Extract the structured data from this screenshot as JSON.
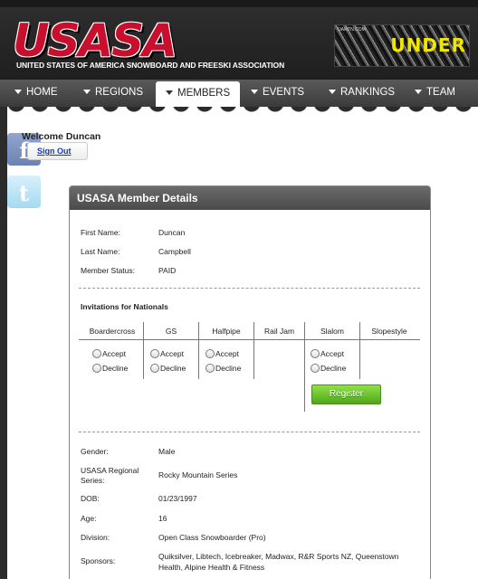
{
  "header": {
    "topstrip_text": "",
    "logo_text": "USASA",
    "logo_tagline": "UNITED STATES OF AMERICA SNOWBOARD AND FREESKI ASSOCIATION",
    "banner_small": "UAMTN.COM",
    "banner_word": "UNDER"
  },
  "nav": {
    "items": [
      {
        "label": "HOME"
      },
      {
        "label": "REGIONS"
      },
      {
        "label": "MEMBERS"
      },
      {
        "label": "EVENTS"
      },
      {
        "label": "RANKINGS"
      },
      {
        "label": "TEAM"
      }
    ],
    "active": "MEMBERS"
  },
  "social": {
    "facebook_glyph": "f",
    "twitter_glyph": "t"
  },
  "user": {
    "welcome": "Welcome Duncan",
    "sign_out": "Sign Out"
  },
  "panel": {
    "title": "USASA Member Details",
    "first_name_label": "First Name:",
    "first_name": "Duncan",
    "last_name_label": "Last Name:",
    "last_name": "Campbell",
    "status_label": "Member Status:",
    "status": "PAID",
    "invitations_title": "Invitations for Nationals",
    "invitation_columns": [
      "Boardercross",
      "GS",
      "Halfpipe",
      "Rail Jam",
      "Slalom",
      "Slopestyle"
    ],
    "accept_label": "Accept",
    "decline_label": "Decline",
    "register_label": "Register",
    "gender_label": "Gender:",
    "gender": "Male",
    "region_label": "USASA Regional Series:",
    "region": "Rocky Mountain Series",
    "dob_label": "DOB:",
    "dob": "01/23/1997",
    "age_label": "Age:",
    "age": "16",
    "division_label": "Division:",
    "division": "Open Class Snowboarder (Pro)",
    "sponsors_label": "Sponsors:",
    "sponsors": "Quiksilver, Libtech, Icebreaker, Madwax, R&R Sports NZ, Queenstown Health, Alpine Health & Fitness"
  }
}
